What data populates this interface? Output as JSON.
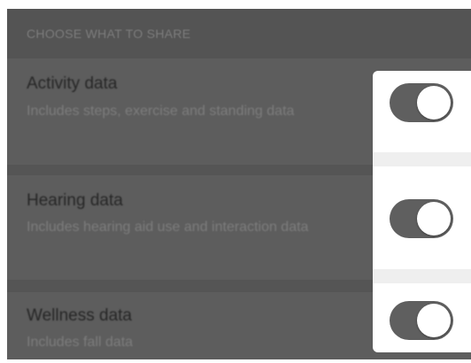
{
  "section": {
    "header": "CHOOSE WHAT TO SHARE"
  },
  "items": [
    {
      "title": "Activity data",
      "subtitle": "Includes steps, exercise and standing data",
      "toggle": "on"
    },
    {
      "title": "Hearing data",
      "subtitle": "Includes hearing aid use and interaction data",
      "toggle": "on"
    },
    {
      "title": "Wellness data",
      "subtitle": "Includes fall data",
      "toggle": "on"
    }
  ],
  "colors": {
    "dim_overlay": "#555555",
    "toggle_track": "#5f5f5f",
    "knob": "#ffffff",
    "spotlight": "#ffffff"
  }
}
